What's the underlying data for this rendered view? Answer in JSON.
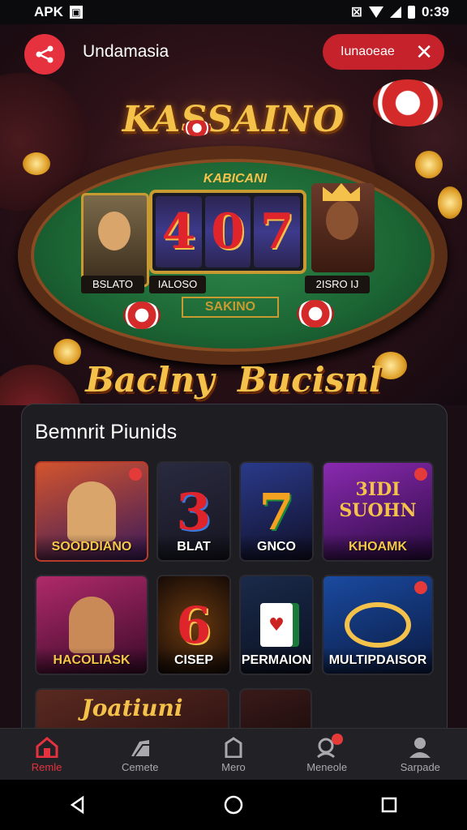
{
  "status_bar": {
    "carrier": "APK",
    "right_text": "0:39"
  },
  "header": {
    "title": "Undamasia",
    "pill_label": "Iunaoeae"
  },
  "hero": {
    "title": "KASSAINO",
    "slot_banner": "KABICANI",
    "reels": [
      "4",
      "0",
      "7"
    ],
    "player_labels": [
      "BSLATO",
      "IALOSO",
      "2ISRO IJ"
    ],
    "table_plate": "SAKINO",
    "subtitle": "Baclny  Bucisnl"
  },
  "games_section": {
    "title": "Bemnrit Piunids",
    "tiles": [
      {
        "label": "SOODDIANO",
        "art": "",
        "colors": [
          "#d2542e",
          "#3b1a5a"
        ]
      },
      {
        "label": "BLAT",
        "art": "3",
        "colors": [
          "#2a2a40",
          "#151520"
        ]
      },
      {
        "label": "GNCO",
        "art": "7",
        "colors": [
          "#2a3a8a",
          "#101028"
        ]
      },
      {
        "label": "KHOAMK",
        "art": "3IDI SUOHN",
        "colors": [
          "#8a2ab0",
          "#2a0a40"
        ]
      },
      {
        "label": "HACOLIASK",
        "art": "",
        "colors": [
          "#b02a6a",
          "#3a0a2a"
        ]
      },
      {
        "label": "CISEP",
        "art": "6",
        "colors": [
          "#3a2010",
          "#150a06"
        ]
      },
      {
        "label": "PERMAION",
        "art": "",
        "colors": [
          "#1a2a4a",
          "#0a1020"
        ]
      },
      {
        "label": "MULTIPDAISOR",
        "art": "",
        "colors": [
          "#1a4aa0",
          "#0a1a40"
        ]
      }
    ],
    "partial_tile_text": "Joatiuni"
  },
  "bottom_nav": {
    "items": [
      {
        "label": "Remle",
        "icon": "home-icon",
        "active": true
      },
      {
        "label": "Cemete",
        "icon": "cards-icon",
        "active": false
      },
      {
        "label": "Mero",
        "icon": "pentagon-icon",
        "active": false
      },
      {
        "label": "Meneole",
        "icon": "search-user-icon",
        "active": false
      },
      {
        "label": "Sarpade",
        "icon": "profile-icon",
        "active": false
      }
    ]
  },
  "colors": {
    "accent": "#e5323e",
    "gold": "#f4c24a",
    "panel": "#1d1d22"
  }
}
